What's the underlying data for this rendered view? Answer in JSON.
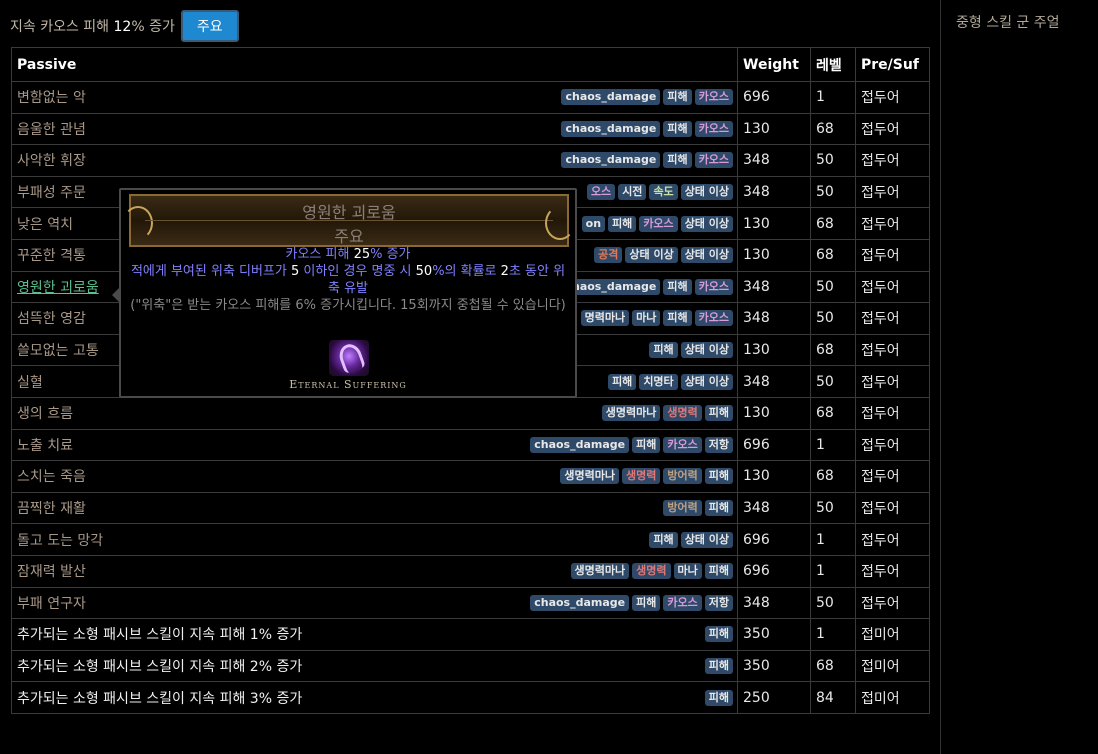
{
  "header": {
    "text_prefix": "지속 카오스 피해 ",
    "text_num": "12",
    "text_suffix": "% 증가",
    "button_label": "주요"
  },
  "sidebar": {
    "title": "중형 스킬 군 주얼"
  },
  "table": {
    "columns": [
      "Passive",
      "Weight",
      "레벨",
      "Pre/Suf"
    ],
    "rows": [
      {
        "name": "변함없는 악",
        "tags": [
          {
            "t": "chaos_damage",
            "c": ""
          },
          {
            "t": "피해",
            "c": ""
          },
          {
            "t": "카오스",
            "c": "chaos"
          }
        ],
        "weight": "696",
        "level": "1",
        "type": "접두어"
      },
      {
        "name": "음울한 관념",
        "tags": [
          {
            "t": "chaos_damage",
            "c": ""
          },
          {
            "t": "피해",
            "c": ""
          },
          {
            "t": "카오스",
            "c": "chaos"
          }
        ],
        "weight": "130",
        "level": "68",
        "type": "접두어"
      },
      {
        "name": "사악한 휘장",
        "tags": [
          {
            "t": "chaos_damage",
            "c": ""
          },
          {
            "t": "피해",
            "c": ""
          },
          {
            "t": "카오스",
            "c": "chaos"
          }
        ],
        "weight": "348",
        "level": "50",
        "type": "접두어"
      },
      {
        "name": "부패성 주문",
        "tags": [
          {
            "t": "오스",
            "c": "chaos"
          },
          {
            "t": "시전",
            "c": ""
          },
          {
            "t": "속도",
            "c": "speed"
          },
          {
            "t": "상태 이상",
            "c": ""
          }
        ],
        "weight": "348",
        "level": "50",
        "type": "접두어"
      },
      {
        "name": "낮은 역치",
        "tags": [
          {
            "t": "on",
            "c": ""
          },
          {
            "t": "피해",
            "c": ""
          },
          {
            "t": "카오스",
            "c": "chaos"
          },
          {
            "t": "상태 이상",
            "c": ""
          }
        ],
        "weight": "130",
        "level": "68",
        "type": "접두어"
      },
      {
        "name": "꾸준한 격통",
        "tags": [
          {
            "t": "공격",
            "c": "attack"
          },
          {
            "t": "상태 이상",
            "c": ""
          },
          {
            "t": "상태 이상",
            "c": ""
          }
        ],
        "weight": "130",
        "level": "68",
        "type": "접두어"
      },
      {
        "name": "영원한 괴로움",
        "tags": [
          {
            "t": "chaos_damage",
            "c": ""
          },
          {
            "t": "피해",
            "c": ""
          },
          {
            "t": "카오스",
            "c": "chaos"
          }
        ],
        "weight": "348",
        "level": "50",
        "type": "접두어",
        "hover": true
      },
      {
        "name": "섬뜩한 영감",
        "tags": [
          {
            "t": "명력마나",
            "c": ""
          },
          {
            "t": "마나",
            "c": ""
          },
          {
            "t": "피해",
            "c": ""
          },
          {
            "t": "카오스",
            "c": "chaos"
          }
        ],
        "weight": "348",
        "level": "50",
        "type": "접두어"
      },
      {
        "name": "쓸모없는 고통",
        "tags": [
          {
            "t": "피해",
            "c": ""
          },
          {
            "t": "상태 이상",
            "c": ""
          }
        ],
        "weight": "130",
        "level": "68",
        "type": "접두어"
      },
      {
        "name": "실혈",
        "tags": [
          {
            "t": "피해",
            "c": ""
          },
          {
            "t": "치명타",
            "c": ""
          },
          {
            "t": "상태 이상",
            "c": ""
          }
        ],
        "weight": "348",
        "level": "50",
        "type": "접두어"
      },
      {
        "name": "생의 흐름",
        "tags": [
          {
            "t": "생명력마나",
            "c": ""
          },
          {
            "t": "생명력",
            "c": "life"
          },
          {
            "t": "피해",
            "c": ""
          }
        ],
        "weight": "130",
        "level": "68",
        "type": "접두어"
      },
      {
        "name": "노출 치료",
        "tags": [
          {
            "t": "chaos_damage",
            "c": ""
          },
          {
            "t": "피해",
            "c": ""
          },
          {
            "t": "카오스",
            "c": "chaos"
          },
          {
            "t": "저항",
            "c": ""
          }
        ],
        "weight": "696",
        "level": "1",
        "type": "접두어"
      },
      {
        "name": "스치는 죽음",
        "tags": [
          {
            "t": "생명력마나",
            "c": ""
          },
          {
            "t": "생명력",
            "c": "life"
          },
          {
            "t": "방어력",
            "c": "armour"
          },
          {
            "t": "피해",
            "c": ""
          }
        ],
        "weight": "130",
        "level": "68",
        "type": "접두어"
      },
      {
        "name": "끔찍한 재활",
        "tags": [
          {
            "t": "방어력",
            "c": "armour"
          },
          {
            "t": "피해",
            "c": ""
          }
        ],
        "weight": "348",
        "level": "50",
        "type": "접두어"
      },
      {
        "name": "돌고 도는 망각",
        "tags": [
          {
            "t": "피해",
            "c": ""
          },
          {
            "t": "상태 이상",
            "c": ""
          }
        ],
        "weight": "696",
        "level": "1",
        "type": "접두어"
      },
      {
        "name": "잠재력 발산",
        "tags": [
          {
            "t": "생명력마나",
            "c": ""
          },
          {
            "t": "생명력",
            "c": "life"
          },
          {
            "t": "마나",
            "c": ""
          },
          {
            "t": "피해",
            "c": ""
          }
        ],
        "weight": "696",
        "level": "1",
        "type": "접두어"
      },
      {
        "name": "부패 연구자",
        "tags": [
          {
            "t": "chaos_damage",
            "c": ""
          },
          {
            "t": "피해",
            "c": ""
          },
          {
            "t": "카오스",
            "c": "chaos"
          },
          {
            "t": "저항",
            "c": ""
          }
        ],
        "weight": "348",
        "level": "50",
        "type": "접두어"
      },
      {
        "name": "추가되는 소형 패시브 스킬이 지속 피해 1% 증가",
        "tags": [
          {
            "t": "피해",
            "c": ""
          }
        ],
        "weight": "350",
        "level": "1",
        "type": "접미어",
        "plain": true
      },
      {
        "name": "추가되는 소형 패시브 스킬이 지속 피해 2% 증가",
        "tags": [
          {
            "t": "피해",
            "c": ""
          }
        ],
        "weight": "350",
        "level": "68",
        "type": "접미어",
        "plain": true
      },
      {
        "name": "추가되는 소형 패시브 스킬이 지속 피해 3% 증가",
        "tags": [
          {
            "t": "피해",
            "c": ""
          }
        ],
        "weight": "250",
        "level": "84",
        "type": "접미어",
        "plain": true
      }
    ]
  },
  "tooltip": {
    "title": "영원한 괴로움",
    "subtitle": "주요",
    "line1_a": "카오스 피해 ",
    "line1_n": "25",
    "line1_b": "% 증가",
    "line2_a": "적에게 부여된 위축 디버프가 ",
    "line2_n1": "5",
    "line2_b": " 이하인 경우 명중 시 ",
    "line2_n2": "50",
    "line2_c": "%의 확률로 ",
    "line2_n3": "2",
    "line2_d": "초 동안 위축 유발",
    "reminder": "(\"위축\"은 받는 카오스 피해를 6% 증가시킵니다. 15회까지 중첩될 수 있습니다)",
    "icon": "eternal-suffering-icon",
    "name_en": "Eternal Suffering"
  }
}
